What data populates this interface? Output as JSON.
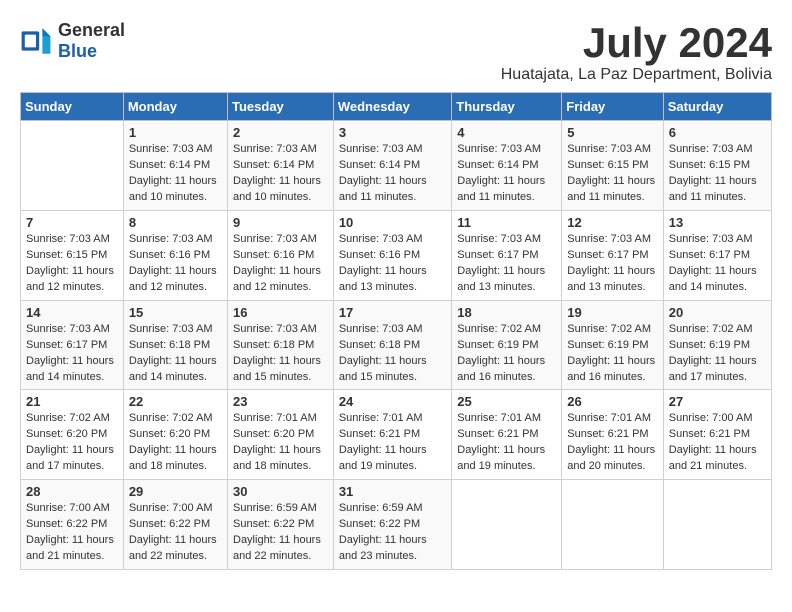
{
  "logo": {
    "general": "General",
    "blue": "Blue"
  },
  "title": "July 2024",
  "subtitle": "Huatajata, La Paz Department, Bolivia",
  "days_of_week": [
    "Sunday",
    "Monday",
    "Tuesday",
    "Wednesday",
    "Thursday",
    "Friday",
    "Saturday"
  ],
  "weeks": [
    [
      {
        "day": "",
        "sunrise": "",
        "sunset": "",
        "daylight": ""
      },
      {
        "day": "1",
        "sunrise": "7:03 AM",
        "sunset": "6:14 PM",
        "daylight": "11 hours and 10 minutes."
      },
      {
        "day": "2",
        "sunrise": "7:03 AM",
        "sunset": "6:14 PM",
        "daylight": "11 hours and 10 minutes."
      },
      {
        "day": "3",
        "sunrise": "7:03 AM",
        "sunset": "6:14 PM",
        "daylight": "11 hours and 11 minutes."
      },
      {
        "day": "4",
        "sunrise": "7:03 AM",
        "sunset": "6:14 PM",
        "daylight": "11 hours and 11 minutes."
      },
      {
        "day": "5",
        "sunrise": "7:03 AM",
        "sunset": "6:15 PM",
        "daylight": "11 hours and 11 minutes."
      },
      {
        "day": "6",
        "sunrise": "7:03 AM",
        "sunset": "6:15 PM",
        "daylight": "11 hours and 11 minutes."
      }
    ],
    [
      {
        "day": "7",
        "sunrise": "7:03 AM",
        "sunset": "6:15 PM",
        "daylight": "11 hours and 12 minutes."
      },
      {
        "day": "8",
        "sunrise": "7:03 AM",
        "sunset": "6:16 PM",
        "daylight": "11 hours and 12 minutes."
      },
      {
        "day": "9",
        "sunrise": "7:03 AM",
        "sunset": "6:16 PM",
        "daylight": "11 hours and 12 minutes."
      },
      {
        "day": "10",
        "sunrise": "7:03 AM",
        "sunset": "6:16 PM",
        "daylight": "11 hours and 13 minutes."
      },
      {
        "day": "11",
        "sunrise": "7:03 AM",
        "sunset": "6:17 PM",
        "daylight": "11 hours and 13 minutes."
      },
      {
        "day": "12",
        "sunrise": "7:03 AM",
        "sunset": "6:17 PM",
        "daylight": "11 hours and 13 minutes."
      },
      {
        "day": "13",
        "sunrise": "7:03 AM",
        "sunset": "6:17 PM",
        "daylight": "11 hours and 14 minutes."
      }
    ],
    [
      {
        "day": "14",
        "sunrise": "7:03 AM",
        "sunset": "6:17 PM",
        "daylight": "11 hours and 14 minutes."
      },
      {
        "day": "15",
        "sunrise": "7:03 AM",
        "sunset": "6:18 PM",
        "daylight": "11 hours and 14 minutes."
      },
      {
        "day": "16",
        "sunrise": "7:03 AM",
        "sunset": "6:18 PM",
        "daylight": "11 hours and 15 minutes."
      },
      {
        "day": "17",
        "sunrise": "7:03 AM",
        "sunset": "6:18 PM",
        "daylight": "11 hours and 15 minutes."
      },
      {
        "day": "18",
        "sunrise": "7:02 AM",
        "sunset": "6:19 PM",
        "daylight": "11 hours and 16 minutes."
      },
      {
        "day": "19",
        "sunrise": "7:02 AM",
        "sunset": "6:19 PM",
        "daylight": "11 hours and 16 minutes."
      },
      {
        "day": "20",
        "sunrise": "7:02 AM",
        "sunset": "6:19 PM",
        "daylight": "11 hours and 17 minutes."
      }
    ],
    [
      {
        "day": "21",
        "sunrise": "7:02 AM",
        "sunset": "6:20 PM",
        "daylight": "11 hours and 17 minutes."
      },
      {
        "day": "22",
        "sunrise": "7:02 AM",
        "sunset": "6:20 PM",
        "daylight": "11 hours and 18 minutes."
      },
      {
        "day": "23",
        "sunrise": "7:01 AM",
        "sunset": "6:20 PM",
        "daylight": "11 hours and 18 minutes."
      },
      {
        "day": "24",
        "sunrise": "7:01 AM",
        "sunset": "6:21 PM",
        "daylight": "11 hours and 19 minutes."
      },
      {
        "day": "25",
        "sunrise": "7:01 AM",
        "sunset": "6:21 PM",
        "daylight": "11 hours and 19 minutes."
      },
      {
        "day": "26",
        "sunrise": "7:01 AM",
        "sunset": "6:21 PM",
        "daylight": "11 hours and 20 minutes."
      },
      {
        "day": "27",
        "sunrise": "7:00 AM",
        "sunset": "6:21 PM",
        "daylight": "11 hours and 21 minutes."
      }
    ],
    [
      {
        "day": "28",
        "sunrise": "7:00 AM",
        "sunset": "6:22 PM",
        "daylight": "11 hours and 21 minutes."
      },
      {
        "day": "29",
        "sunrise": "7:00 AM",
        "sunset": "6:22 PM",
        "daylight": "11 hours and 22 minutes."
      },
      {
        "day": "30",
        "sunrise": "6:59 AM",
        "sunset": "6:22 PM",
        "daylight": "11 hours and 22 minutes."
      },
      {
        "day": "31",
        "sunrise": "6:59 AM",
        "sunset": "6:22 PM",
        "daylight": "11 hours and 23 minutes."
      },
      {
        "day": "",
        "sunrise": "",
        "sunset": "",
        "daylight": ""
      },
      {
        "day": "",
        "sunrise": "",
        "sunset": "",
        "daylight": ""
      },
      {
        "day": "",
        "sunrise": "",
        "sunset": "",
        "daylight": ""
      }
    ]
  ],
  "labels": {
    "sunrise": "Sunrise:",
    "sunset": "Sunset:",
    "daylight": "Daylight:"
  }
}
